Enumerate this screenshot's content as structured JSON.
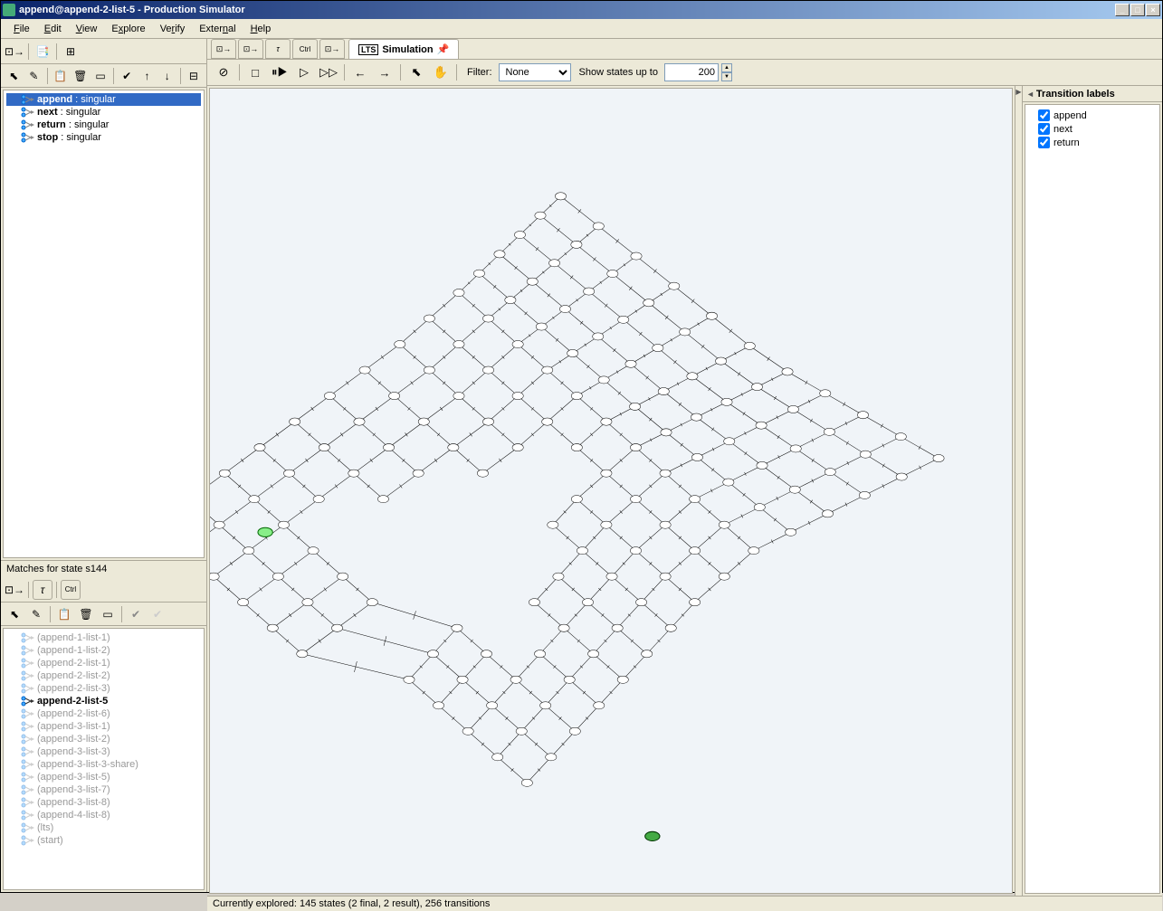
{
  "title": "append@append-2-list-5 - Production Simulator",
  "menu": [
    "File",
    "Edit",
    "View",
    "Explore",
    "Verify",
    "External",
    "Help"
  ],
  "rules": [
    {
      "name": "append",
      "kind": "singular",
      "selected": true
    },
    {
      "name": "next",
      "kind": "singular",
      "selected": false
    },
    {
      "name": "return",
      "kind": "singular",
      "selected": false
    },
    {
      "name": "stop",
      "kind": "singular",
      "selected": false
    }
  ],
  "matches_label": "Matches for state s144",
  "matches": [
    {
      "label": "(append-1-list-1)",
      "gray": true
    },
    {
      "label": "(append-1-list-2)",
      "gray": true
    },
    {
      "label": "(append-2-list-1)",
      "gray": true
    },
    {
      "label": "(append-2-list-2)",
      "gray": true
    },
    {
      "label": "(append-2-list-3)",
      "gray": true
    },
    {
      "label": "append-2-list-5",
      "gray": false,
      "bold": true
    },
    {
      "label": "(append-2-list-6)",
      "gray": true
    },
    {
      "label": "(append-3-list-1)",
      "gray": true
    },
    {
      "label": "(append-3-list-2)",
      "gray": true
    },
    {
      "label": "(append-3-list-3)",
      "gray": true
    },
    {
      "label": "(append-3-list-3-share)",
      "gray": true
    },
    {
      "label": "(append-3-list-5)",
      "gray": true
    },
    {
      "label": "(append-3-list-7)",
      "gray": true
    },
    {
      "label": "(append-3-list-8)",
      "gray": true
    },
    {
      "label": "(append-4-list-8)",
      "gray": true
    },
    {
      "label": "(lts)",
      "gray": true
    },
    {
      "label": "(start)",
      "gray": true
    }
  ],
  "tabs": {
    "lts": "LTS",
    "sim": "Simulation"
  },
  "filter": {
    "label": "Filter:",
    "value": "None"
  },
  "show_states": {
    "label": "Show states up to",
    "value": "200"
  },
  "status": "Currently explored: 145 states (2 final, 2 result), 256 transitions",
  "labels_panel": {
    "header": "Transition labels",
    "items": [
      "append",
      "next",
      "return"
    ]
  }
}
